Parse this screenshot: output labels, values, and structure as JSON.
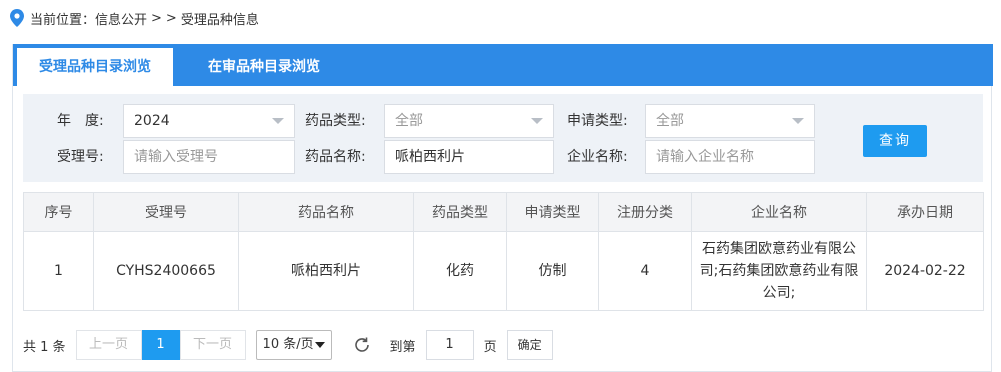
{
  "breadcrumb": {
    "location_label": "当前位置：信息公开",
    "sep1": ">",
    "sep2": ">",
    "current": "受理品种信息"
  },
  "tabs": [
    {
      "label": "受理品种目录浏览"
    },
    {
      "label": "在审品种目录浏览"
    }
  ],
  "filters": {
    "year_label": "年　度:",
    "year_value": "2024",
    "drug_type_label": "药品类型:",
    "drug_type_value": "全部",
    "apply_type_label": "申请类型:",
    "apply_type_value": "全部",
    "accept_no_label": "受理号:",
    "accept_no_placeholder": "请输入受理号",
    "drug_name_label": "药品名称:",
    "drug_name_value": "哌柏西利片",
    "company_label": "企业名称:",
    "company_placeholder": "请输入企业名称",
    "query_button": "查询"
  },
  "table": {
    "headers": [
      "序号",
      "受理号",
      "药品名称",
      "药品类型",
      "申请类型",
      "注册分类",
      "企业名称",
      "承办日期"
    ],
    "rows": [
      [
        "1",
        "CYHS2400665",
        "哌柏西利片",
        "化药",
        "仿制",
        "4",
        "石药集团欧意药业有限公司;石药集团欧意药业有限公司;",
        "2024-02-22"
      ]
    ]
  },
  "pager": {
    "total_text": "共 1 条",
    "prev": "上一页",
    "current_page": "1",
    "next": "下一页",
    "page_size": "10 条/页",
    "goto_label": "到第",
    "goto_value": "1",
    "page_unit": "页",
    "confirm": "确定"
  },
  "colors": {
    "accent": "#2e8ae6",
    "button": "#1e9bf0",
    "filter_bg": "#eef2f7"
  },
  "icons": [
    "location-pin-icon",
    "refresh-icon",
    "dropdown-caret-icon"
  ]
}
